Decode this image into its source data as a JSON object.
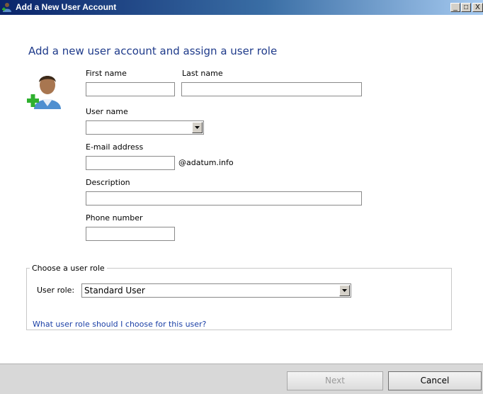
{
  "window": {
    "title": "Add a New User Account",
    "controls": {
      "minimize": "_",
      "maximize": "□",
      "close": "X"
    }
  },
  "heading": "Add a new user account and assign a user role",
  "form": {
    "first_name": {
      "label": "First name",
      "value": ""
    },
    "last_name": {
      "label": "Last name",
      "value": ""
    },
    "user_name": {
      "label": "User name",
      "value": ""
    },
    "email": {
      "label": "E-mail address",
      "value": "",
      "domain_suffix": "@adatum.info"
    },
    "description": {
      "label": "Description",
      "value": ""
    },
    "phone": {
      "label": "Phone number",
      "value": ""
    }
  },
  "role_group": {
    "legend": "Choose a user role",
    "role_label": "User role:",
    "role_value": "Standard User",
    "help_link": "What user role should I choose for this user?"
  },
  "footer": {
    "next_label": "Next",
    "cancel_label": "Cancel"
  },
  "icons": {
    "window_icon": "user-icon",
    "hero_icon": "add-user-icon",
    "dropdown": "chevron-down-icon"
  },
  "colors": {
    "heading": "#1e3a8a",
    "link": "#1a3fa6",
    "titlebar_start": "#0a246a",
    "footer_bg": "#d8d8d8"
  }
}
